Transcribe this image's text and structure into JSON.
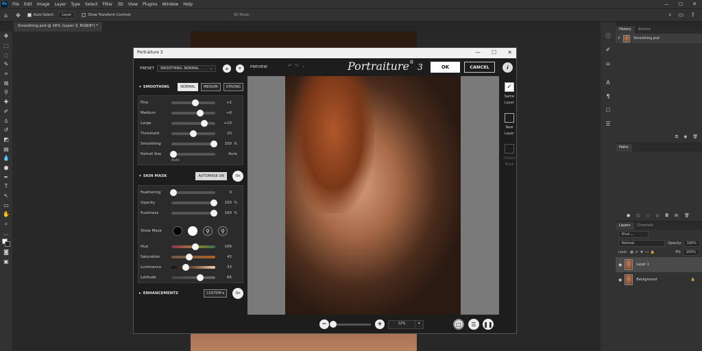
{
  "menu": {
    "logo": "Ps",
    "items": [
      "File",
      "Edit",
      "Image",
      "Layer",
      "Type",
      "Select",
      "Filter",
      "3D",
      "View",
      "Plugins",
      "Window",
      "Help"
    ]
  },
  "options": {
    "auto_select_label": "Auto-Select:",
    "auto_select_value": "Layer",
    "show_transform_label": "Show Transform Controls",
    "mode_3d_label": "3D Mode:"
  },
  "document": {
    "tab_title": "Smoothing.psd @ 16% (Layer 3, RGB/8*) *"
  },
  "dialog": {
    "title": "Portraiture 3",
    "preset_label": "PRESET",
    "preset_value": "SMOOTHING: NORMAL",
    "preview_label": "PREVIEW",
    "brand": "Portraiture",
    "brand_mark": "®",
    "brand_version": "3",
    "ok_label": "OK",
    "cancel_label": "CANCEL",
    "info_label": "i",
    "smoothing": {
      "header": "SMOOTHING",
      "modes": [
        "NORMAL",
        "MEDIUM",
        "STRONG"
      ],
      "active_mode": "NORMAL",
      "sliders": [
        {
          "label": "Fine",
          "value": "+2",
          "unit": "",
          "pos": 0.55
        },
        {
          "label": "Medium",
          "value": "+6",
          "unit": "",
          "pos": 0.65
        },
        {
          "label": "Large",
          "value": "+10",
          "unit": "",
          "pos": 0.75
        },
        {
          "label": "Threshold",
          "value": "20",
          "unit": "",
          "pos": 0.5
        },
        {
          "label": "Smoothing",
          "value": "100",
          "unit": "%",
          "pos": 0.97
        }
      ],
      "portrait_size_label": "Portrait Size",
      "portrait_size_value": "Auto",
      "portrait_size_sub": "Auto"
    },
    "skin_mask": {
      "header": "SKIN MASK",
      "automask_label": "AUTOMASK ON",
      "on_label": "On",
      "sliders": [
        {
          "label": "Feathering",
          "value": "0",
          "unit": "",
          "pos": 0.05
        },
        {
          "label": "Opacity",
          "value": "100",
          "unit": "%",
          "pos": 0.97
        },
        {
          "label": "Fuzziness",
          "value": "100",
          "unit": "%",
          "pos": 0.97
        }
      ],
      "show_mask_label": "Show Mask",
      "color_sliders": [
        {
          "label": "Hue",
          "value": "106",
          "pos": 0.55
        },
        {
          "label": "Saturation",
          "value": "42",
          "pos": 0.4
        },
        {
          "label": "Luminance",
          "value": "33",
          "pos": 0.33
        },
        {
          "label": "Latitude",
          "value": "66",
          "pos": 0.66
        }
      ]
    },
    "enhancements": {
      "header": "ENHANCEMENTS",
      "mode_label": "CUSTOM",
      "on_label": "On"
    },
    "right_side": {
      "same_layer": "Same Layer",
      "new_layer": "New Layer",
      "output_mask": "Output Mask"
    },
    "zoom_value": "12%"
  },
  "history_panel": {
    "tabs": [
      "History",
      "Actions"
    ],
    "item": "Smoothing.psd"
  },
  "paths_panel": {
    "tab": "Paths"
  },
  "layers_panel": {
    "tabs": [
      "Layers",
      "Channels"
    ],
    "kind_label": "Kind",
    "blend_mode": "Normal",
    "opacity_label": "Opacity:",
    "opacity_value": "100%",
    "lock_label": "Lock:",
    "fill_label": "Fill:",
    "fill_value": "100%",
    "layers": [
      "Layer 1",
      "Background"
    ]
  }
}
